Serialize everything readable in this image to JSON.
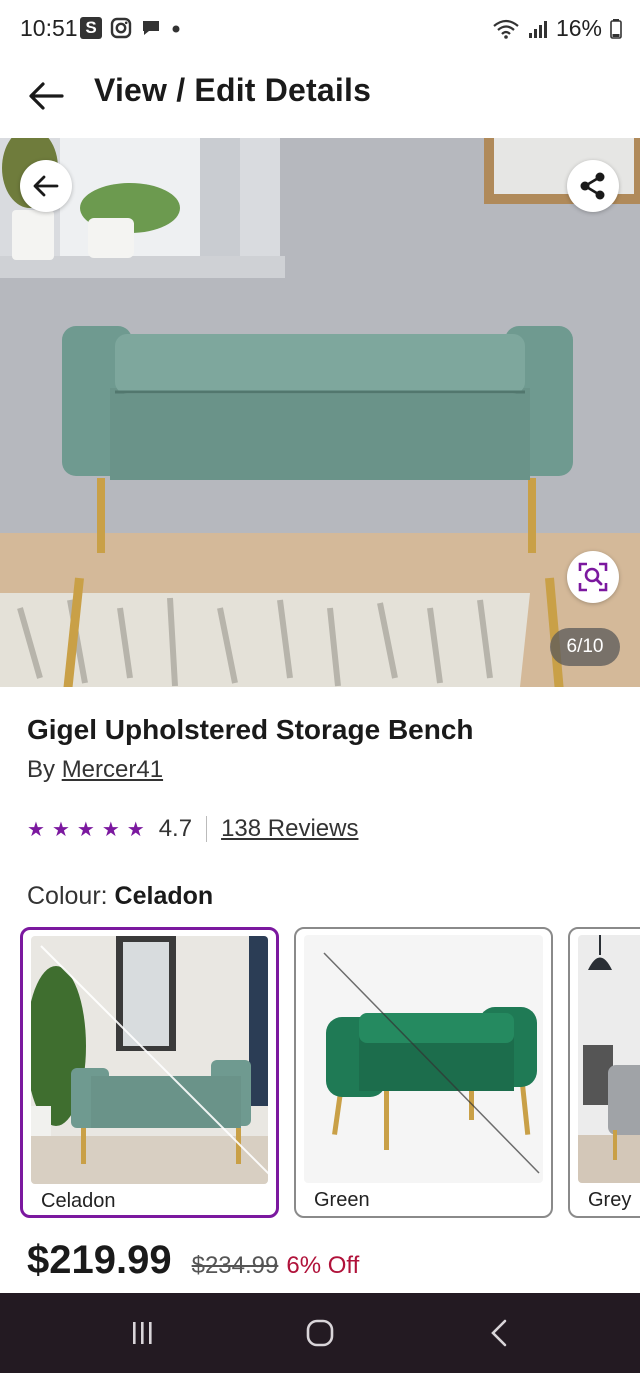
{
  "status_bar": {
    "time": "10:51",
    "s_badge": "S",
    "battery": "16%"
  },
  "header": {
    "title": "View / Edit Details"
  },
  "gallery": {
    "counter": "6/10"
  },
  "product": {
    "title": "Gigel Upholstered Storage Bench",
    "by_prefix": "By",
    "brand": "Mercer41",
    "rating": "4.7",
    "rating_fraction": 0.94,
    "reviews": "138 Reviews"
  },
  "colour": {
    "label": "Colour:",
    "selected": "Celadon",
    "options": [
      {
        "name": "Celadon"
      },
      {
        "name": "Green"
      },
      {
        "name": "Grey"
      }
    ]
  },
  "price": {
    "current": "$219.99",
    "original": "$234.99",
    "discount": "6% Off"
  },
  "colors": {
    "accent": "#7b189f",
    "sale": "#b0123a",
    "nav_bg": "#231a22"
  }
}
